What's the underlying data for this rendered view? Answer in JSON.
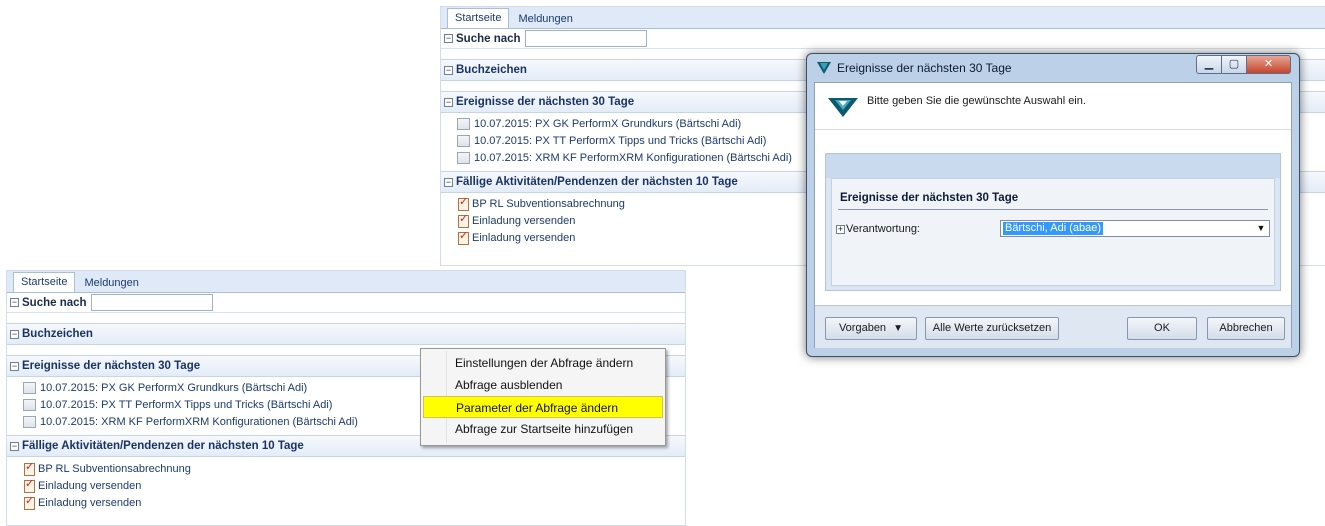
{
  "tabs": [
    "Startseite",
    "Meldungen"
  ],
  "search_label": "Suche nach",
  "sections": {
    "bookmarks": "Buchzeichen",
    "events": "Ereignisse der nächsten 30 Tage",
    "tasks": "Fällige Aktivitäten/Pendenzen der nächsten 10 Tage"
  },
  "events": [
    "10.07.2015: PX GK PerformX Grundkurs (Bärtschi Adi)",
    "10.07.2015: PX TT PerformX Tipps und Tricks (Bärtschi Adi)",
    "10.07.2015: XRM KF PerformXRM Konfigurationen (Bärtschi Adi)"
  ],
  "tasks": [
    "BP RL Subventionsabrechnung",
    "Einladung versenden",
    "Einladung versenden"
  ],
  "context_menu": [
    "Einstellungen der Abfrage ändern",
    "Abfrage ausblenden",
    "Parameter der Abfrage ändern",
    "Abfrage zur Startseite hinzufügen"
  ],
  "dialog": {
    "title": "Ereignisse der nächsten 30 Tage",
    "message": "Bitte geben Sie die gewünschte Auswahl ein.",
    "group_title": "Ereignisse der nächsten 30 Tage",
    "field_label": "Verantwortung:",
    "field_value": "Bärtschi, Adi (abae)",
    "buttons": {
      "defaults": "Vorgaben",
      "reset": "Alle Werte zurücksetzen",
      "ok": "OK",
      "cancel": "Abbrechen"
    }
  },
  "colors": {
    "highlight": "#ffff00",
    "tab_bar": "#dfe9f7",
    "selection": "#3399ff",
    "brand": "#0b5a70"
  }
}
